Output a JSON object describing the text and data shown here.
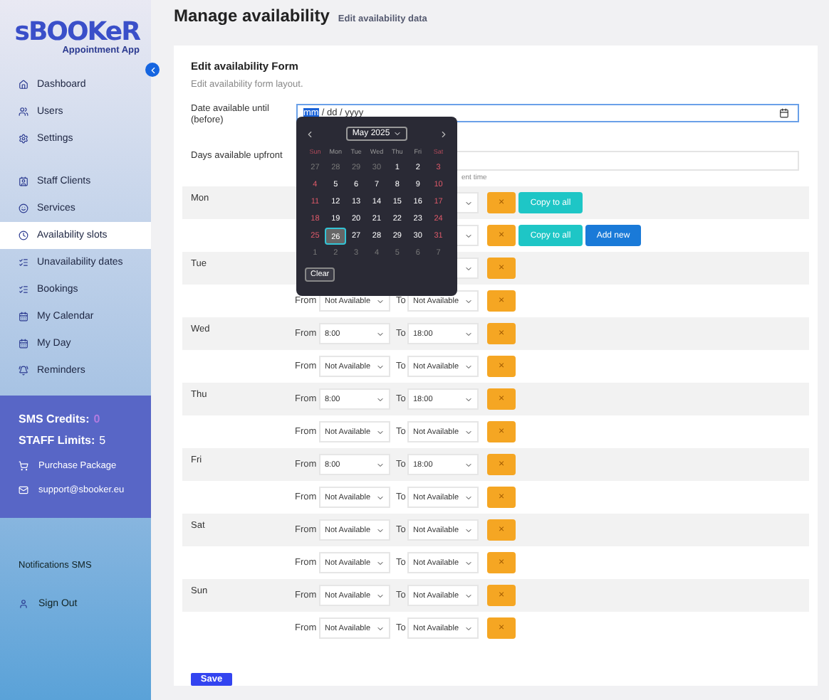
{
  "sidebar": {
    "logo": {
      "name": "sBOOKeR",
      "subtitle": "Appointment App"
    },
    "groups": [
      [
        {
          "label": "Dashboard",
          "selected": false
        },
        {
          "label": "Users",
          "selected": false
        },
        {
          "label": "Settings",
          "selected": false
        }
      ],
      [
        {
          "label": "Staff Clients",
          "selected": false
        },
        {
          "label": "Services",
          "selected": false
        },
        {
          "label": "Availability slots",
          "selected": true
        },
        {
          "label": "Unavailability dates",
          "selected": false
        },
        {
          "label": "Bookings",
          "selected": false
        },
        {
          "label": "My Calendar",
          "selected": false
        },
        {
          "label": "My Day",
          "selected": false
        },
        {
          "label": "Reminders",
          "selected": false
        }
      ]
    ],
    "account": {
      "sms_credits_label": "SMS Credits:",
      "sms_credits_value": "0",
      "staff_limits_label": "STAFF Limits:",
      "staff_limits_value": "5",
      "links": [
        "Purchase Package",
        "support@sbooker.eu"
      ]
    },
    "notifications": "Notifications SMS",
    "sign_out": "Sign Out"
  },
  "header": {
    "title": "Manage availability",
    "subtitle": "Edit availability data"
  },
  "form": {
    "title": "Edit availability Form",
    "description": "Edit availability form layout.",
    "date_field": {
      "label": "Date available until (before)",
      "segments": [
        {
          "text": "mm",
          "selected": true
        },
        {
          "text": "/ dd / yyyy",
          "selected": false
        }
      ]
    },
    "days_field": {
      "label": "Days available upfront",
      "hint": "ent time"
    },
    "calendar": {
      "month": "May 2025",
      "weekdays": [
        "Sun",
        "Mon",
        "Tue",
        "Wed",
        "Thu",
        "Fri",
        "Sat"
      ],
      "weeks": [
        [
          {
            "d": "27",
            "other": true,
            "selected": false
          },
          {
            "d": "28",
            "other": true,
            "selected": false
          },
          {
            "d": "29",
            "other": true,
            "selected": false
          },
          {
            "d": "30",
            "other": true,
            "selected": false
          },
          {
            "d": "1",
            "other": false,
            "selected": false
          },
          {
            "d": "2",
            "other": false,
            "selected": false
          },
          {
            "d": "3",
            "other": false,
            "selected": false
          }
        ],
        [
          {
            "d": "4",
            "other": false,
            "selected": false
          },
          {
            "d": "5",
            "other": false,
            "selected": false
          },
          {
            "d": "6",
            "other": false,
            "selected": false
          },
          {
            "d": "7",
            "other": false,
            "selected": false
          },
          {
            "d": "8",
            "other": false,
            "selected": false
          },
          {
            "d": "9",
            "other": false,
            "selected": false
          },
          {
            "d": "10",
            "other": false,
            "selected": false
          }
        ],
        [
          {
            "d": "11",
            "other": false,
            "selected": false
          },
          {
            "d": "12",
            "other": false,
            "selected": false
          },
          {
            "d": "13",
            "other": false,
            "selected": false
          },
          {
            "d": "14",
            "other": false,
            "selected": false
          },
          {
            "d": "15",
            "other": false,
            "selected": false
          },
          {
            "d": "16",
            "other": false,
            "selected": false
          },
          {
            "d": "17",
            "other": false,
            "selected": false
          }
        ],
        [
          {
            "d": "18",
            "other": false,
            "selected": false
          },
          {
            "d": "19",
            "other": false,
            "selected": false
          },
          {
            "d": "20",
            "other": false,
            "selected": false
          },
          {
            "d": "21",
            "other": false,
            "selected": false
          },
          {
            "d": "22",
            "other": false,
            "selected": false
          },
          {
            "d": "23",
            "other": false,
            "selected": false
          },
          {
            "d": "24",
            "other": false,
            "selected": false
          }
        ],
        [
          {
            "d": "25",
            "other": false,
            "selected": false
          },
          {
            "d": "26",
            "other": false,
            "selected": true
          },
          {
            "d": "27",
            "other": false,
            "selected": false
          },
          {
            "d": "28",
            "other": false,
            "selected": false
          },
          {
            "d": "29",
            "other": false,
            "selected": false
          },
          {
            "d": "30",
            "other": false,
            "selected": false
          },
          {
            "d": "31",
            "other": false,
            "selected": false
          }
        ],
        [
          {
            "d": "1",
            "other": true,
            "selected": false
          },
          {
            "d": "2",
            "other": true,
            "selected": false
          },
          {
            "d": "3",
            "other": true,
            "selected": false
          },
          {
            "d": "4",
            "other": true,
            "selected": false
          },
          {
            "d": "5",
            "other": true,
            "selected": false
          },
          {
            "d": "6",
            "other": true,
            "selected": false
          },
          {
            "d": "7",
            "other": true,
            "selected": false
          }
        ]
      ],
      "clear": "Clear"
    },
    "schedule": [
      {
        "day": "Mon",
        "slots": [
          {
            "actions": [
              {
                "kind": "remove",
                "label": "×"
              },
              {
                "kind": "copy",
                "label": "Copy to all"
              }
            ]
          },
          {
            "actions": [
              {
                "kind": "remove",
                "label": "×"
              },
              {
                "kind": "copy",
                "label": "Copy to all"
              },
              {
                "kind": "add",
                "label": "Add new"
              }
            ]
          }
        ]
      },
      {
        "day": "Tue",
        "slots": [
          {
            "actions": [
              {
                "kind": "remove",
                "label": "×"
              }
            ]
          },
          {
            "from_label": "From",
            "from": "Not Available",
            "to_label": "To",
            "to": "Not Available",
            "actions": [
              {
                "kind": "remove",
                "label": "×"
              }
            ]
          }
        ]
      },
      {
        "day": "Wed",
        "slots": [
          {
            "from_label": "From",
            "from": "8:00",
            "to_label": "To",
            "to": "18:00",
            "actions": [
              {
                "kind": "remove",
                "label": "×"
              }
            ]
          },
          {
            "from_label": "From",
            "from": "Not Available",
            "to_label": "To",
            "to": "Not Available",
            "actions": [
              {
                "kind": "remove",
                "label": "×"
              }
            ]
          }
        ]
      },
      {
        "day": "Thu",
        "slots": [
          {
            "from_label": "From",
            "from": "8:00",
            "to_label": "To",
            "to": "18:00",
            "actions": [
              {
                "kind": "remove",
                "label": "×"
              }
            ]
          },
          {
            "from_label": "From",
            "from": "Not Available",
            "to_label": "To",
            "to": "Not Available",
            "actions": [
              {
                "kind": "remove",
                "label": "×"
              }
            ]
          }
        ]
      },
      {
        "day": "Fri",
        "slots": [
          {
            "from_label": "From",
            "from": "8:00",
            "to_label": "To",
            "to": "18:00",
            "actions": [
              {
                "kind": "remove",
                "label": "×"
              }
            ]
          },
          {
            "from_label": "From",
            "from": "Not Available",
            "to_label": "To",
            "to": "Not Available",
            "actions": [
              {
                "kind": "remove",
                "label": "×"
              }
            ]
          }
        ]
      },
      {
        "day": "Sat",
        "slots": [
          {
            "from_label": "From",
            "from": "Not Available",
            "to_label": "To",
            "to": "Not Available",
            "actions": [
              {
                "kind": "remove",
                "label": "×"
              }
            ]
          },
          {
            "from_label": "From",
            "from": "Not Available",
            "to_label": "To",
            "to": "Not Available",
            "actions": [
              {
                "kind": "remove",
                "label": "×"
              }
            ]
          }
        ]
      },
      {
        "day": "Sun",
        "slots": [
          {
            "from_label": "From",
            "from": "Not Available",
            "to_label": "To",
            "to": "Not Available",
            "actions": [
              {
                "kind": "remove",
                "label": "×"
              }
            ]
          },
          {
            "from_label": "From",
            "from": "Not Available",
            "to_label": "To",
            "to": "Not Available",
            "actions": [
              {
                "kind": "remove",
                "label": "×"
              }
            ]
          }
        ]
      }
    ],
    "save": "Save"
  }
}
